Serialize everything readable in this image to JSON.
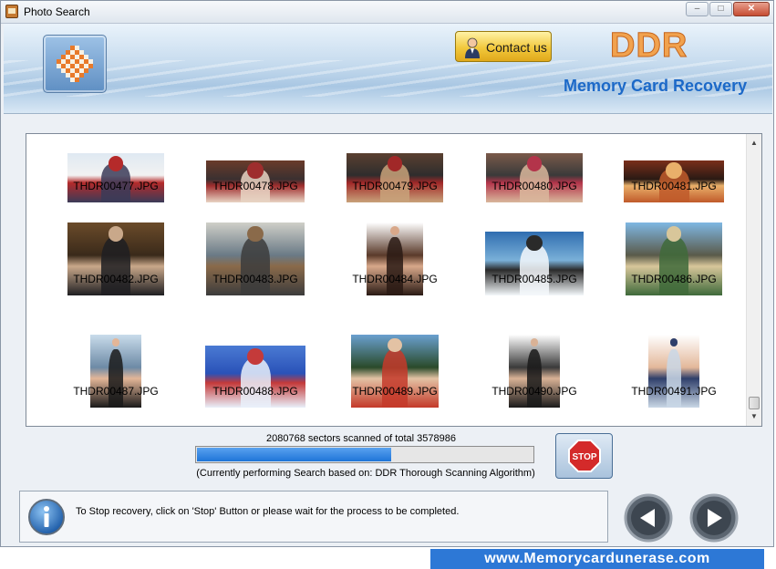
{
  "window": {
    "title": "Photo Search",
    "controls": [
      "minimize",
      "maximize",
      "close"
    ]
  },
  "header": {
    "contact_label": "Contact us",
    "brand": "DDR",
    "product": "Memory Card Recovery"
  },
  "gallery": {
    "photos": [
      {
        "name": "THDR00477.JPG",
        "scene": "snow-group"
      },
      {
        "name": "THDR00478.JPG",
        "scene": "dinner-party"
      },
      {
        "name": "THDR00479.JPG",
        "scene": "street-dance"
      },
      {
        "name": "THDR00480.JPG",
        "scene": "crowd-portrait"
      },
      {
        "name": "THDR00481.JPG",
        "scene": "ballroom-crowd"
      },
      {
        "name": "THDR00482.JPG",
        "scene": "two-men-indoors"
      },
      {
        "name": "THDR00483.JPG",
        "scene": "office-workers"
      },
      {
        "name": "THDR00484.JPG",
        "scene": "woman-portrait"
      },
      {
        "name": "THDR00485.JPG",
        "scene": "beach-waves"
      },
      {
        "name": "THDR00486.JPG",
        "scene": "rock-island"
      },
      {
        "name": "THDR00487.JPG",
        "scene": "woman-black-dress"
      },
      {
        "name": "THDR00488.JPG",
        "scene": "beach-umbrella"
      },
      {
        "name": "THDR00489.JPG",
        "scene": "friends-outdoors"
      },
      {
        "name": "THDR00490.JPG",
        "scene": "businesswoman-desk"
      },
      {
        "name": "THDR00491.JPG",
        "scene": "woman-standing"
      }
    ]
  },
  "scan": {
    "sectors_text": "2080768 sectors scanned of total 3578986",
    "progress_fraction": 0.58,
    "algorithm_text": "(Currently performing Search based on:  DDR Thorough Scanning Algorithm)",
    "stop_label": "STOP"
  },
  "footer": {
    "message": "To Stop recovery, click on 'Stop' Button or please wait for the process to be completed."
  },
  "banner": {
    "url": "www.Memorycardunerase.com"
  },
  "colors": {
    "accent": "#2d78d6",
    "brand": "#f1a24e",
    "progress": "#1e74d8",
    "stop": "#d42a2a"
  }
}
